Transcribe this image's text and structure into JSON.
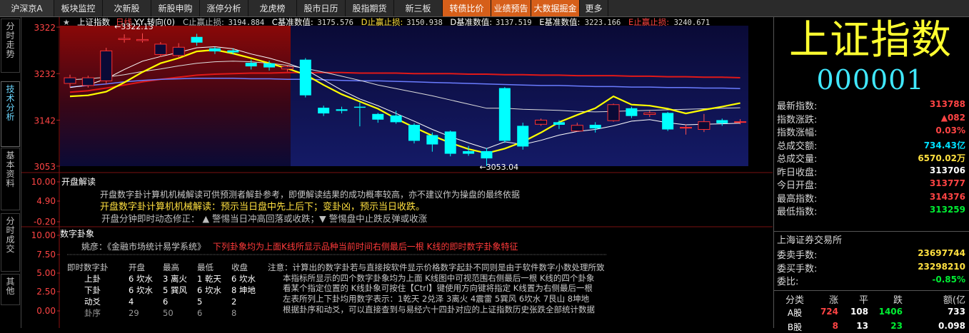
{
  "topnav": {
    "tabs": [
      {
        "label": "沪深京A",
        "style": "first",
        "w": 76
      },
      {
        "label": "板块监控",
        "style": "",
        "w": 68
      },
      {
        "label": "次新股",
        "style": "",
        "w": 68
      },
      {
        "label": "新股申购",
        "style": "",
        "w": 68
      },
      {
        "label": "涨停分析",
        "style": "",
        "w": 68
      },
      {
        "label": "龙虎榜",
        "style": "",
        "w": 68
      },
      {
        "label": "股市日历",
        "style": "",
        "w": 68
      },
      {
        "label": "股指期货",
        "style": "",
        "w": 68
      },
      {
        "label": "新三板",
        "style": "",
        "w": 68
      },
      {
        "label": "转债比价",
        "style": "orange",
        "w": 68
      },
      {
        "label": "业绩预告",
        "style": "orange",
        "w": 56
      },
      {
        "label": "大数据掘金",
        "style": "orange",
        "w": 68
      },
      {
        "label": "更多",
        "style": "",
        "w": 40
      }
    ]
  },
  "leftbar": {
    "tabs": [
      {
        "label": "分时走势",
        "active": false
      },
      {
        "label": "技术分析",
        "active": true
      },
      {
        "label": "基本资料",
        "active": false
      },
      {
        "label": "分时成交",
        "active": false
      },
      {
        "label": "其他",
        "active": false
      }
    ]
  },
  "chart_header": {
    "name": "上证指数",
    "period": "日线",
    "rights": "YY 转向(0)",
    "items": [
      {
        "label": "C止赢止损:",
        "value": "3194.884",
        "color": "#bbbbbb"
      },
      {
        "label": "C基准数值:",
        "value": "3175.576",
        "color": "#ffffff"
      },
      {
        "label": "D止赢止损:",
        "value": "3150.938",
        "color": "#ffe040"
      },
      {
        "label": "D基准数值:",
        "value": "3137.519",
        "color": "#ffffff"
      },
      {
        "label": "E基准数值:",
        "value": "3223.166",
        "color": "#ffffff"
      },
      {
        "label": "E止赢止损:",
        "value": "3240.671",
        "color": "#ff4444"
      }
    ]
  },
  "chart_data": {
    "type": "candlestick",
    "title": "上证指数",
    "yticks": [
      3322,
      3232,
      3142,
      3053
    ],
    "ylim": [
      3053,
      3322
    ],
    "annotations": [
      {
        "text": "3322.13",
        "value": 3322.13
      },
      {
        "text": "3053.04",
        "value": 3053.04
      }
    ],
    "candles": [
      {
        "o": 3213,
        "c": 3224,
        "h": 3230,
        "l": 3205
      },
      {
        "o": 3209,
        "c": 3224,
        "h": 3228,
        "l": 3205
      },
      {
        "o": 3218,
        "c": 3276,
        "h": 3282,
        "l": 3212
      },
      {
        "o": 3298,
        "c": 3300,
        "h": 3308,
        "l": 3292
      },
      {
        "o": 3296,
        "c": 3298,
        "h": 3310,
        "l": 3292
      },
      {
        "o": 3269,
        "c": 3289,
        "h": 3293,
        "l": 3264
      },
      {
        "o": 3267,
        "c": 3283,
        "h": 3291,
        "l": 3262
      },
      {
        "o": 3303,
        "c": 3292,
        "h": 3309,
        "l": 3286
      },
      {
        "o": 3281,
        "c": 3275,
        "h": 3284,
        "l": 3270
      },
      {
        "o": 3277,
        "c": 3273,
        "h": 3281,
        "l": 3269
      },
      {
        "o": 3253,
        "c": 3246,
        "h": 3259,
        "l": 3240
      },
      {
        "o": 3252,
        "c": 3244,
        "h": 3257,
        "l": 3238
      },
      {
        "o": 3241,
        "c": 3245,
        "h": 3248,
        "l": 3236
      },
      {
        "o": 3259,
        "c": 3190,
        "h": 3262,
        "l": 3186
      },
      {
        "o": 3166,
        "c": 3155,
        "h": 3170,
        "l": 3150
      },
      {
        "o": 3163,
        "c": 3160,
        "h": 3168,
        "l": 3155
      },
      {
        "o": 3168,
        "c": 3166,
        "h": 3176,
        "l": 3130
      },
      {
        "o": 3154,
        "c": 3143,
        "h": 3156,
        "l": 3137
      },
      {
        "o": 3151,
        "c": 3138,
        "h": 3160,
        "l": 3135
      },
      {
        "o": 3133,
        "c": 3102,
        "h": 3136,
        "l": 3097
      },
      {
        "o": 3113,
        "c": 3095,
        "h": 3118,
        "l": 3081
      },
      {
        "o": 3120,
        "c": 3077,
        "h": 3122,
        "l": 3072
      },
      {
        "o": 3082,
        "c": 3077,
        "h": 3092,
        "l": 3073
      },
      {
        "o": 3082,
        "c": 3068,
        "h": 3088,
        "l": 3053
      },
      {
        "o": 3204,
        "c": 3102,
        "h": 3206,
        "l": 3098
      },
      {
        "o": 3131,
        "c": 3091,
        "h": 3137,
        "l": 3085
      },
      {
        "o": 3134,
        "c": 3142,
        "h": 3145,
        "l": 3131
      },
      {
        "o": 3138,
        "c": 3133,
        "h": 3142,
        "l": 3125
      },
      {
        "o": 3121,
        "c": 3132,
        "h": 3137,
        "l": 3120
      },
      {
        "o": 3133,
        "c": 3126,
        "h": 3138,
        "l": 3118
      },
      {
        "o": 3141,
        "c": 3172,
        "h": 3174,
        "l": 3139
      },
      {
        "o": 3165,
        "c": 3150,
        "h": 3168,
        "l": 3146
      },
      {
        "o": 3153,
        "c": 3156,
        "h": 3160,
        "l": 3148
      },
      {
        "o": 3156,
        "c": 3124,
        "h": 3158,
        "l": 3121
      },
      {
        "o": 3127,
        "c": 3128,
        "h": 3134,
        "l": 3114
      },
      {
        "o": 3124,
        "c": 3139,
        "h": 3154,
        "l": 3119
      },
      {
        "o": 3142,
        "c": 3136,
        "h": 3145,
        "l": 3131
      },
      {
        "o": 3138,
        "c": 3139,
        "h": 3144,
        "l": 3134
      }
    ],
    "ma_red": [
      3196,
      3199,
      3204,
      3210,
      3216,
      3221,
      3225,
      3229,
      3231,
      3232,
      3233,
      3233,
      3234,
      3234,
      3234,
      3234,
      3233,
      3233,
      3233,
      3232,
      3232,
      3232,
      3231,
      3231,
      3230,
      3230,
      3229,
      3229,
      3228,
      3228,
      3228,
      3227,
      3227,
      3226,
      3226,
      3225,
      3225,
      3224
    ],
    "ma_blue": [
      3206,
      3209,
      3212,
      3216,
      3219,
      3221,
      3222,
      3223,
      3223,
      3223,
      3222,
      3222,
      3221,
      3221,
      3220,
      3219,
      3218,
      3218,
      3217,
      3216,
      3215,
      3214,
      3213,
      3212,
      3211,
      3210,
      3209,
      3209,
      3208,
      3207,
      3207,
      3206,
      3206,
      3205,
      3205,
      3204,
      3204,
      3203
    ],
    "ma_white1": [
      3205,
      3210,
      3222,
      3240,
      3256,
      3265,
      3273,
      3282,
      3284,
      3280,
      3270,
      3262,
      3252,
      3240,
      3220,
      3200,
      3183,
      3170,
      3155,
      3140,
      3124,
      3110,
      3098,
      3087,
      3100,
      3095,
      3103,
      3113,
      3120,
      3124,
      3131,
      3140,
      3143,
      3137,
      3133,
      3134,
      3135,
      3136
    ],
    "ma_white2": [
      3220,
      3222,
      3225,
      3230,
      3236,
      3241,
      3247,
      3252,
      3255,
      3256,
      3255,
      3252,
      3248,
      3242,
      3235,
      3227,
      3219,
      3210,
      3203,
      3196,
      3189,
      3181,
      3173,
      3165,
      3165,
      3163,
      3162,
      3161,
      3159,
      3158,
      3159,
      3160,
      3161,
      3162,
      3163,
      3164,
      3165,
      3166
    ],
    "ma_yellow": [
      3188,
      3190,
      3197,
      3215,
      3235,
      3252,
      3262,
      3275,
      3278,
      3271,
      3262,
      3252,
      3242,
      3230,
      3210,
      3192,
      3178,
      3164,
      3145,
      3128,
      3112,
      3098,
      3086,
      3078,
      3087,
      3100,
      3118,
      3138,
      3152,
      3165,
      3188,
      3172,
      3170,
      3164,
      3155,
      3162,
      3168,
      3175
    ],
    "ma_yellow2": [
      3154,
      3155,
      3160,
      3171,
      3189,
      3210,
      3223,
      3244,
      3263,
      3275,
      3290,
      3282,
      3276,
      3260,
      3240,
      3210,
      3196,
      3178,
      3159,
      3133,
      3118,
      3106,
      3090,
      3079,
      3110,
      3080,
      3089,
      3094,
      3096,
      3099,
      3103,
      3122,
      3118,
      3118,
      3127,
      3140,
      3125,
      3132
    ]
  },
  "panel_open": {
    "title": "开盘解读",
    "yticks": [
      "10.00",
      "4.90",
      "-0.20"
    ],
    "line1": "开盘数字卦计算机机械解读可供预测者解卦参考，即便解读结果的成功概率较高，亦不建议作为操盘的最终依据",
    "line2": "开盘数字卦计算机机械解读：预示当日盘中先上后下；变卦凶，预示当日收跌。",
    "line3": "开盘分钟即时动态修正：  ▲ 警惕当日冲高回落或收跌；▼ 警惕盘中止跌反弹或收涨"
  },
  "panel_gua": {
    "title": "数字卦象",
    "yticks": [
      "10.00",
      "7.50",
      "5.00",
      "2.50",
      "0.00"
    ],
    "yao_prefix": "姚彦：《金融市场统计易学系统》",
    "yao_red": "下列卦象均为上面K线所显示品种当前时间右侧最后一根 K线的即时数字卦象特征",
    "table": {
      "headers": [
        "即时数字卦",
        "开盘",
        "最高",
        "最低",
        "收盘"
      ],
      "rows": [
        [
          "上卦",
          "6 坎水",
          "3 离火",
          "1 乾天",
          "6 坎水"
        ],
        [
          "下卦",
          "6 坎水",
          "5 巽风",
          "6 坎水",
          "8 坤地"
        ],
        [
          "动爻",
          "4",
          "6",
          "5",
          "2"
        ],
        [
          "卦序",
          "29",
          "50",
          "6",
          "8"
        ]
      ]
    },
    "notes": [
      "注意：计算出的数字卦若与直接按软件显示价格数字起卦不同则是由于软件数字小数处理所致",
      "本指标所显示的四个数字卦象均为上面 K线图中可视范围右侧最后一根 K线的四个卦象",
      "看某个指定位置的 K线卦象可按住【Ctrl】键使用方向键将指定 K线置为右侧最后一根",
      "左表所列上下卦均用数字表示：1乾天 2兑泽 3离火 4震雷 5巽风 6坎水 7艮山 8坤地",
      "根据卦序和动爻，可以直接查到与易经六十四卦对应的上证指数历史张跌全部统计数据"
    ]
  },
  "right": {
    "name": "上证指数",
    "code": "000001",
    "stats": [
      {
        "label": "最新指数:",
        "value": "313788",
        "color": "red"
      },
      {
        "label": "指数涨跌:",
        "value": "▲082",
        "color": "red"
      },
      {
        "label": "指数涨幅:",
        "value": "0.03%",
        "color": "red"
      },
      {
        "label": "总成交额:",
        "value": "734.43亿",
        "color": "cyan"
      },
      {
        "label": "总成交量:",
        "value": "6570.02万",
        "color": "yellow"
      },
      {
        "label": "昨日收盘:",
        "value": "313706",
        "color": "white"
      },
      {
        "label": "今日开盘:",
        "value": "313777",
        "color": "red"
      },
      {
        "label": "最高指数:",
        "value": "314376",
        "color": "red"
      },
      {
        "label": "最低指数:",
        "value": "313259",
        "color": "green"
      }
    ],
    "exchange": "上海证券交易所",
    "stats2": [
      {
        "label": "委卖手数:",
        "value": "23697744",
        "color": "yellow"
      },
      {
        "label": "委买手数:",
        "value": "23298210",
        "color": "yellow"
      },
      {
        "label": "委比:",
        "value": "-0.85%",
        "color": "green"
      }
    ],
    "table_headers": [
      "分类",
      "涨",
      "平",
      "跌",
      "额(亿"
    ],
    "table_rows": [
      [
        "A股",
        "724",
        "108",
        "1406",
        "733"
      ],
      [
        "B股",
        "8",
        "13",
        "23",
        "0.098"
      ]
    ]
  }
}
